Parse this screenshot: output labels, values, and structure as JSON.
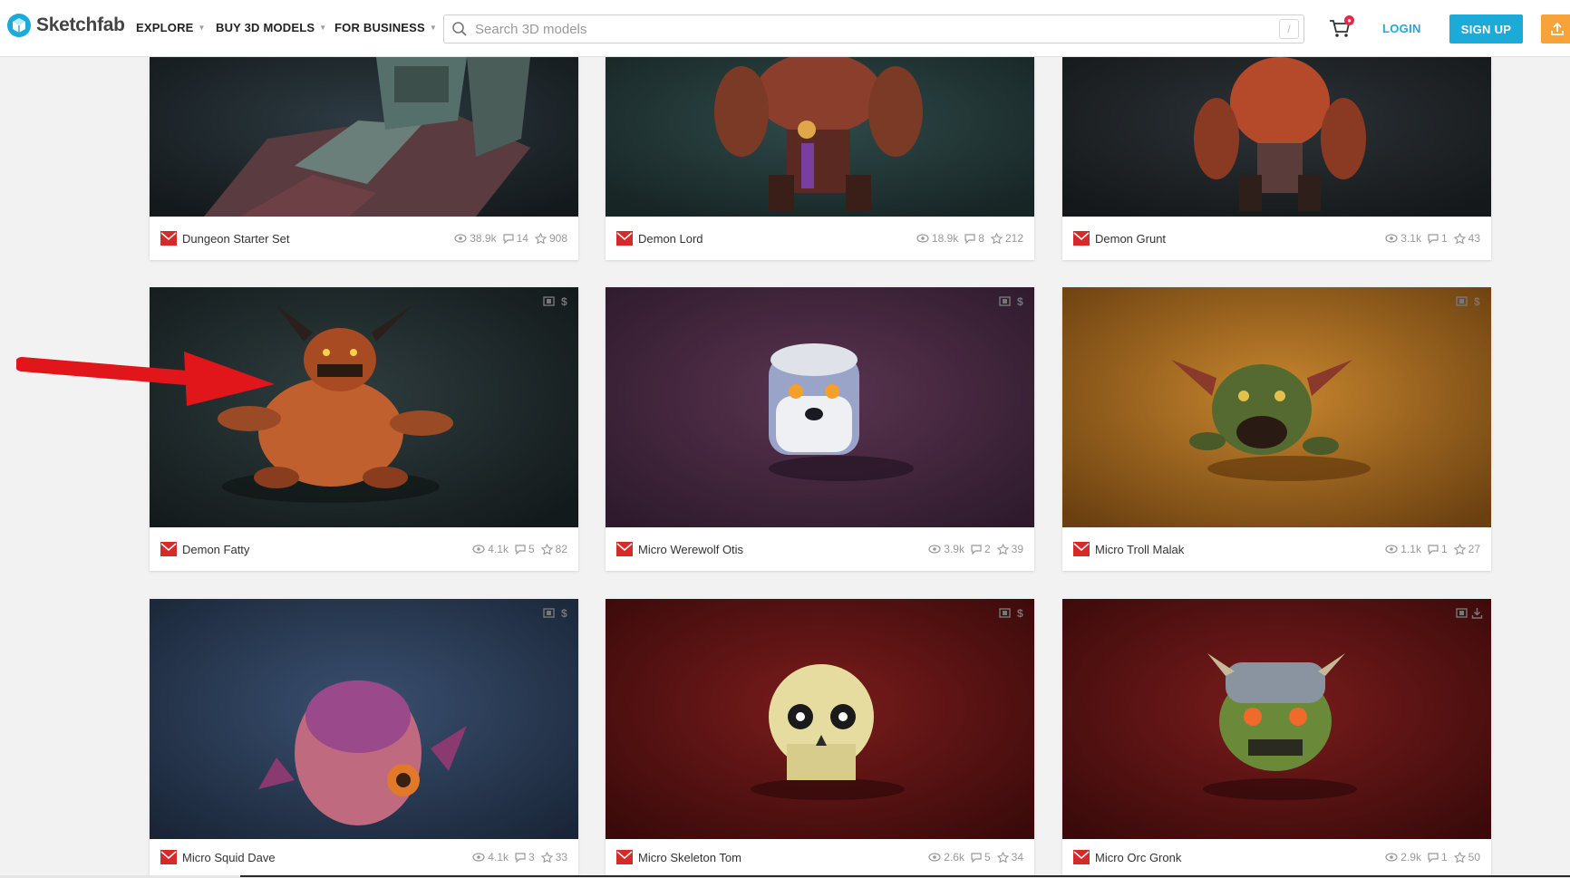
{
  "brand": {
    "name": "Sketchfab",
    "color": "#1caad9"
  },
  "nav": {
    "explore": "EXPLORE",
    "buy": "BUY 3D MODELS",
    "business": "FOR BUSINESS"
  },
  "search": {
    "placeholder": "Search 3D models",
    "shortcut": "/"
  },
  "cart": {
    "icon": "cart-icon"
  },
  "auth": {
    "login": "LOGIN",
    "signup": "SIGN UP",
    "upload_icon": "upload-icon"
  },
  "colors": {
    "accent": "#1caad9",
    "upload": "#f8a23a",
    "arrow": "#e0161b",
    "avatar": "#d62a2a"
  },
  "models": [
    {
      "title": "Dungeon Starter Set",
      "views": "38.9k",
      "comments": "14",
      "likes": "908",
      "badges": []
    },
    {
      "title": "Demon Lord",
      "views": "18.9k",
      "comments": "8",
      "likes": "212",
      "badges": []
    },
    {
      "title": "Demon Grunt",
      "views": "3.1k",
      "comments": "1",
      "likes": "43",
      "badges": []
    },
    {
      "title": "Demon Fatty",
      "views": "4.1k",
      "comments": "5",
      "likes": "82",
      "badges": [
        "film-icon",
        "price-icon"
      ]
    },
    {
      "title": "Micro Werewolf Otis",
      "views": "3.9k",
      "comments": "2",
      "likes": "39",
      "badges": [
        "film-icon",
        "price-icon"
      ]
    },
    {
      "title": "Micro Troll Malak",
      "views": "1.1k",
      "comments": "1",
      "likes": "27",
      "badges": [
        "film-icon",
        "price-icon"
      ]
    },
    {
      "title": "Micro Squid Dave",
      "views": "4.1k",
      "comments": "3",
      "likes": "33",
      "badges": [
        "film-icon",
        "price-icon"
      ]
    },
    {
      "title": "Micro Skeleton Tom",
      "views": "2.6k",
      "comments": "5",
      "likes": "34",
      "badges": [
        "film-icon",
        "price-icon"
      ]
    },
    {
      "title": "Micro Orc Gronk",
      "views": "2.9k",
      "comments": "1",
      "likes": "50",
      "badges": [
        "film-icon",
        "download-icon"
      ]
    }
  ]
}
